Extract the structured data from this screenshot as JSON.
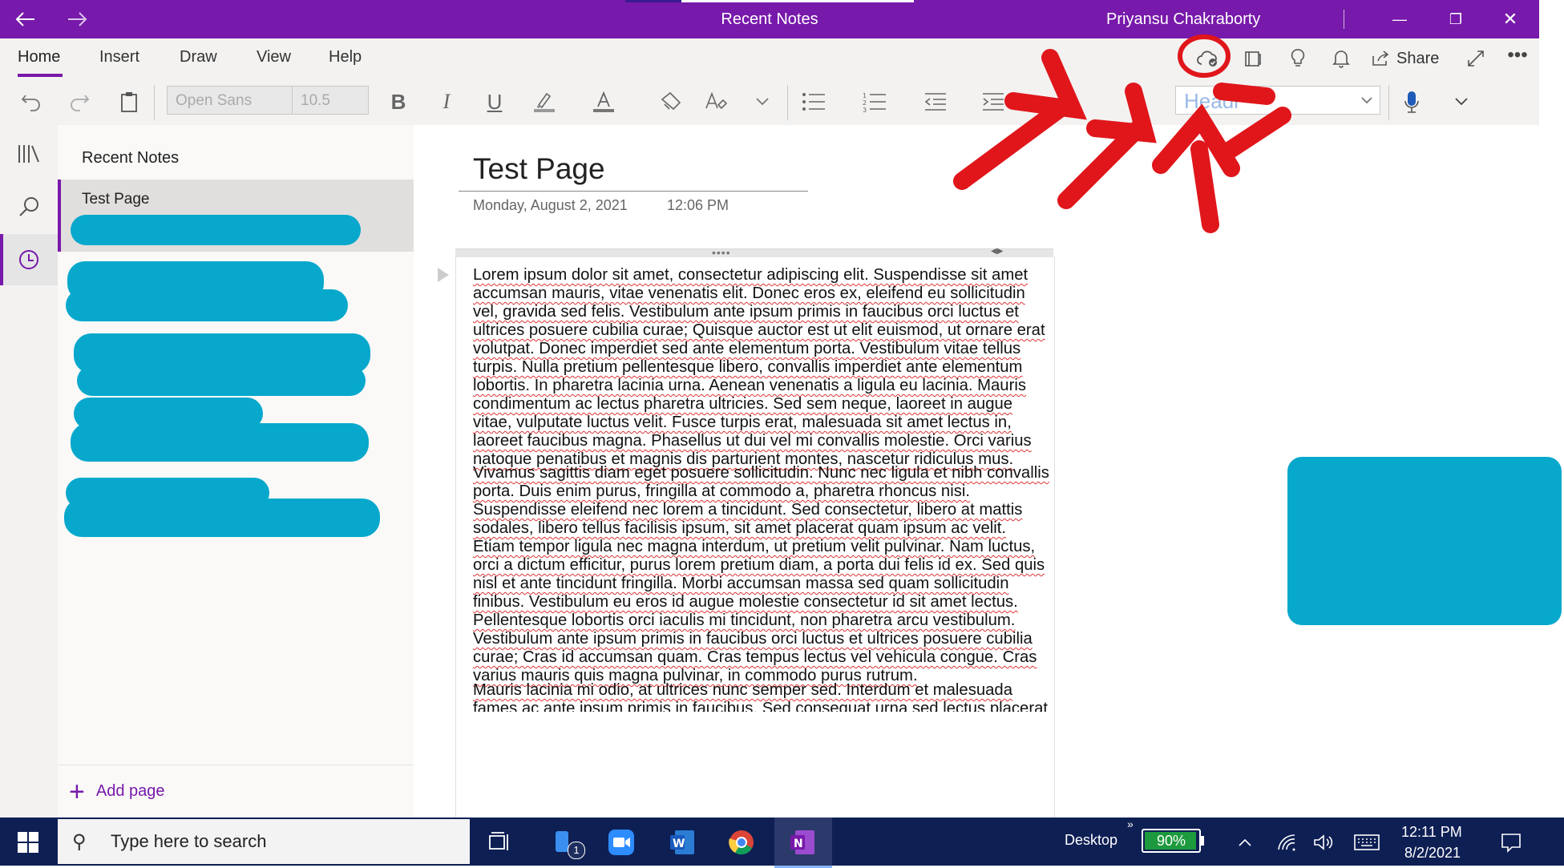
{
  "titlebar": {
    "title": "Recent Notes",
    "user": "Priyansu Chakraborty",
    "back_icon": "arrow-left-icon",
    "forward_icon": "arrow-right-icon",
    "minimize": "—",
    "maximize": "❐",
    "close": "✕",
    "colors": {
      "bar": "#7719aa"
    }
  },
  "menubar": {
    "tabs": [
      "Home",
      "Insert",
      "Draw",
      "View",
      "Help"
    ],
    "share_label": "Share"
  },
  "toolbar": {
    "font_name": "Open Sans",
    "font_size": "10.5",
    "style_placeholder": "Headi"
  },
  "pagelist": {
    "title": "Recent Notes",
    "active_page": "Test Page",
    "add_page": "Add page"
  },
  "page": {
    "title": "Test Page",
    "date": "Monday, August 2, 2021",
    "time": "12:06 PM",
    "paragraphs": [
      "Lorem ipsum dolor sit amet, consectetur adipiscing elit. Suspendisse sit amet accumsan mauris, vitae venenatis elit. Donec eros ex, eleifend eu sollicitudin vel, gravida sed felis. Vestibulum ante ipsum primis in faucibus orci luctus et ultrices posuere cubilia curae; Quisque auctor est ut elit euismod, ut ornare erat volutpat. Donec imperdiet sed ante elementum porta. Vestibulum vitae tellus turpis. Nulla pretium pellentesque libero, convallis imperdiet ante elementum lobortis. In pharetra lacinia urna. Aenean venenatis a ligula eu lacinia. Mauris condimentum ac lectus pharetra ultricies. Sed sem neque, laoreet in augue vitae, vulputate luctus velit. Fusce turpis erat, malesuada sit amet lectus in, laoreet faucibus magna. Phasellus ut dui vel mi convallis molestie. Orci varius natoque penatibus et magnis dis parturient montes, nascetur ridiculus mus.",
      "Vivamus sagittis diam eget posuere sollicitudin. Nunc nec ligula et nibh convallis porta. Duis enim purus, fringilla at commodo a, pharetra rhoncus nisi. Suspendisse eleifend nec lorem a tincidunt. Sed consectetur, libero at mattis sodales, libero tellus facilisis ipsum, sit amet placerat quam ipsum ac velit. Etiam tempor ligula nec magna interdum, ut pretium velit pulvinar. Nam luctus, orci a dictum efficitur, purus lorem pretium diam, a porta dui felis id ex. Sed quis nisl et ante tincidunt fringilla. Morbi accumsan massa sed quam sollicitudin finibus. Vestibulum eu eros id augue molestie consectetur id sit amet lectus. Pellentesque lobortis orci iaculis mi tincidunt, non pharetra arcu vestibulum. Vestibulum ante ipsum primis in faucibus orci luctus et ultrices posuere cubilia curae; Cras id accumsan quam. Cras tempus lectus vel vehicula congue. Cras varius mauris quis magna pulvinar, in commodo purus rutrum.",
      "Mauris lacinia mi odio, at ultrices nunc semper sed. Interdum et malesuada fames ac ante ipsum primis in faucibus. Sed consequat urna sed lectus placerat vehicula. Nunc posuere"
    ]
  },
  "taskbar": {
    "search_placeholder": "Type here to search",
    "desktop_label": "Desktop",
    "battery": "90%",
    "time": "12:11 PM",
    "date": "8/2/2021",
    "notification_badge": "1"
  }
}
